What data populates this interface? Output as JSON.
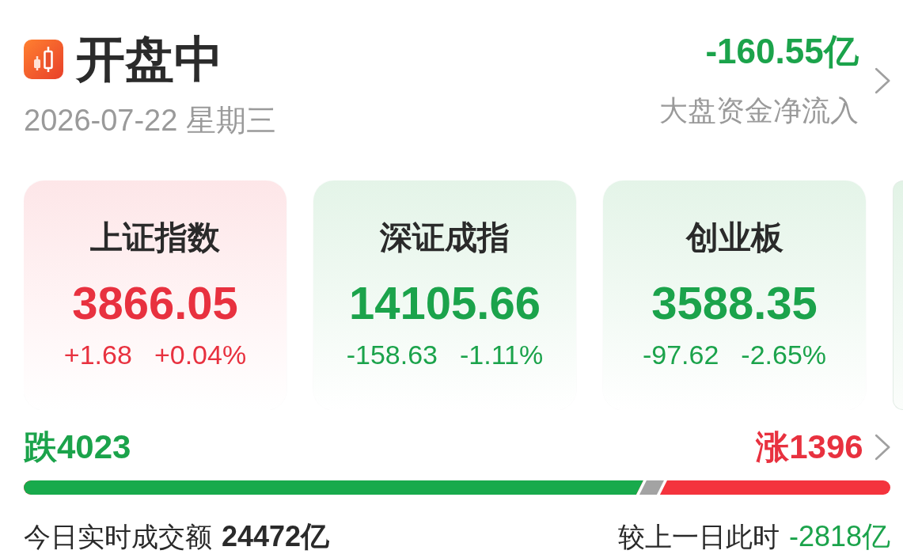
{
  "header": {
    "title": "开盘中",
    "date": "2026-07-22 星期三",
    "net_inflow": {
      "value": "-160.55亿",
      "label": "大盘资金净流入",
      "rising": false
    }
  },
  "indices": [
    {
      "name": "上证指数",
      "value": "3866.05",
      "change": "+1.68",
      "change_pct": "+0.04%",
      "rising": true
    },
    {
      "name": "深证成指",
      "value": "14105.66",
      "change": "-158.63",
      "change_pct": "-1.11%",
      "rising": false
    },
    {
      "name": "创业板",
      "value": "3588.35",
      "change": "-97.62",
      "change_pct": "-2.65%",
      "rising": false
    }
  ],
  "breadth": {
    "fall_label": "跌4023",
    "rise_label": "涨1396",
    "level": 0.715
  },
  "turnover": {
    "label": "今日实时成交额",
    "value": "24472亿",
    "compare_label": "较上一日此时",
    "compare_value": "-2818亿",
    "compare_rising": false
  }
}
